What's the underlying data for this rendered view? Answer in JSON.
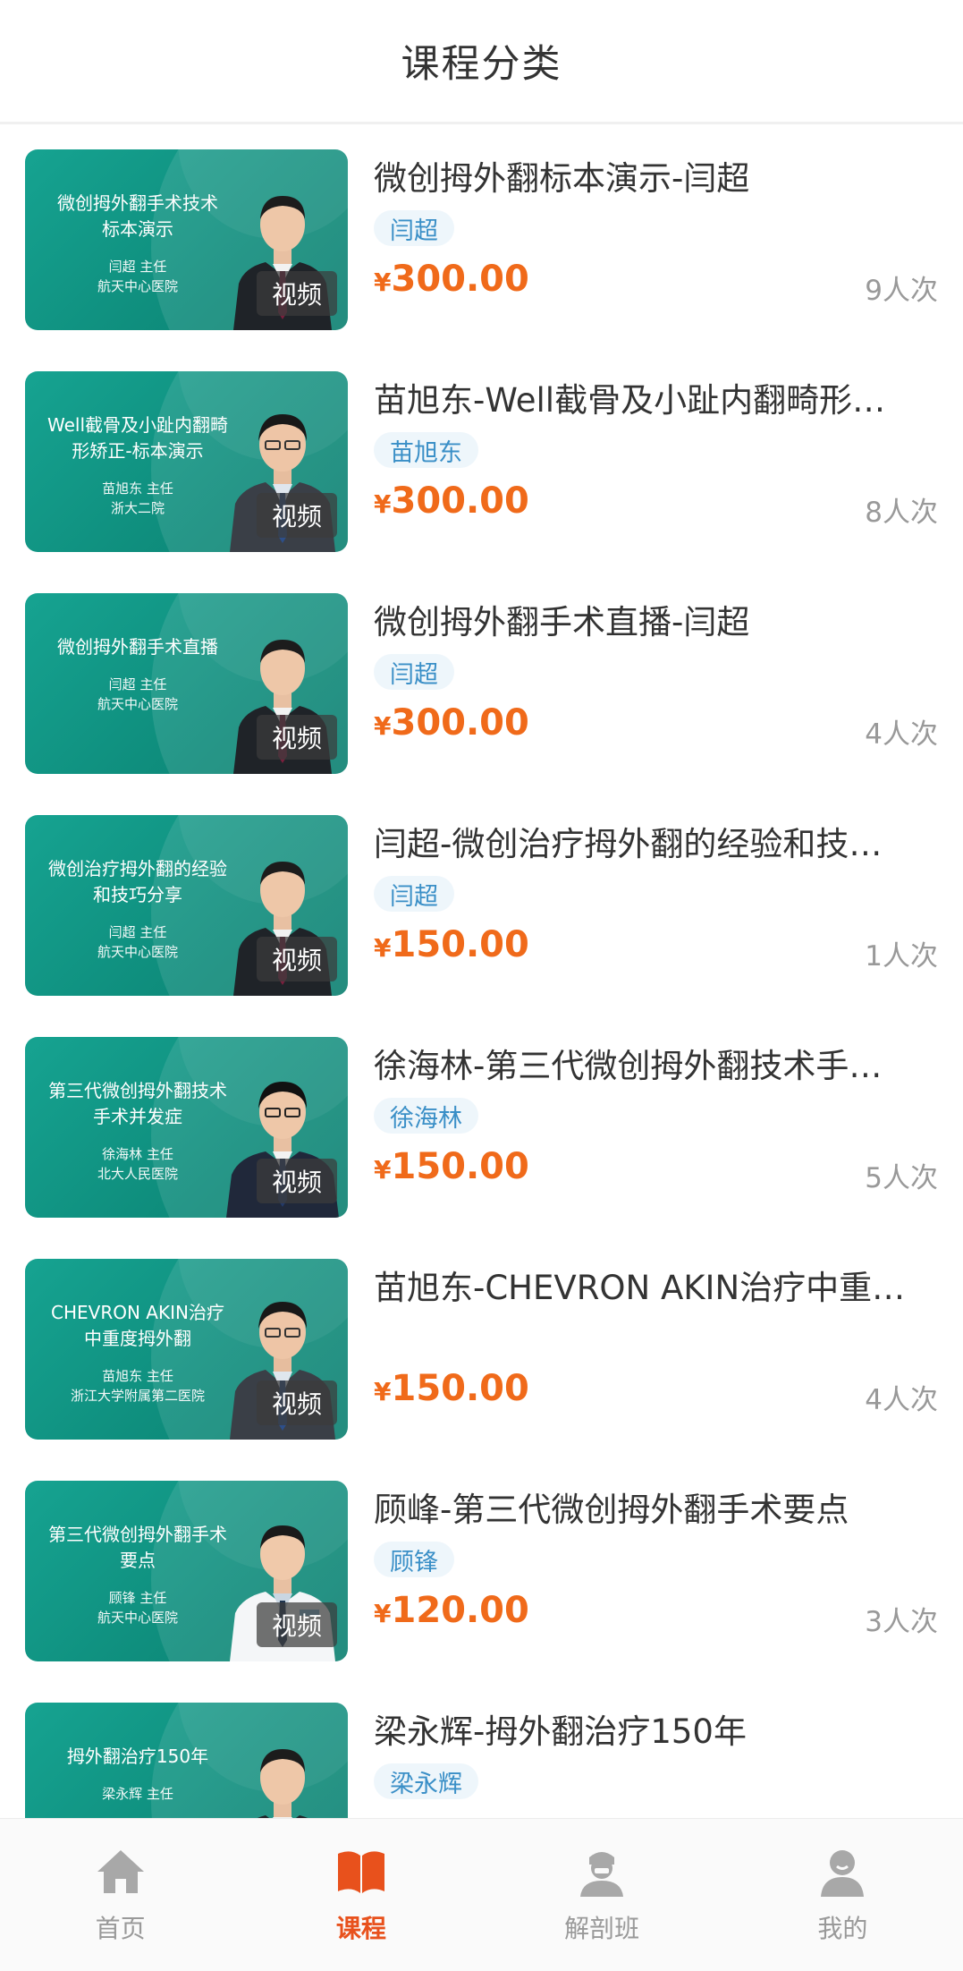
{
  "header": {
    "title": "课程分类"
  },
  "common": {
    "video_label": "视频",
    "currency": "¥"
  },
  "courses": [
    {
      "thumb_title": "微创拇外翻手术技术\n标本演示",
      "thumb_info": "闫超  主任\n航天中心医院",
      "title": "微创拇外翻标本演示-闫超",
      "teacher": "闫超",
      "price": "300.00",
      "count": "9人次"
    },
    {
      "thumb_title": "Well截骨及小趾内翻畸\n形矫正-标本演示",
      "thumb_info": "苗旭东  主任\n浙大二院",
      "title": "苗旭东-Well截骨及小趾内翻畸形…",
      "teacher": "苗旭东",
      "price": "300.00",
      "count": "8人次"
    },
    {
      "thumb_title": "微创拇外翻手术直播",
      "thumb_info": "闫超  主任\n航天中心医院",
      "title": "微创拇外翻手术直播-闫超",
      "teacher": "闫超",
      "price": "300.00",
      "count": "4人次"
    },
    {
      "thumb_title": "微创治疗拇外翻的经验\n和技巧分享",
      "thumb_info": "闫超  主任\n航天中心医院",
      "title": "闫超-微创治疗拇外翻的经验和技…",
      "teacher": "闫超",
      "price": "150.00",
      "count": "1人次"
    },
    {
      "thumb_title": "第三代微创拇外翻技术\n手术并发症",
      "thumb_info": "徐海林  主任\n北大人民医院",
      "title": "徐海林-第三代微创拇外翻技术手…",
      "teacher": "徐海林",
      "price": "150.00",
      "count": "5人次"
    },
    {
      "thumb_title": "CHEVRON AKIN治疗\n中重度拇外翻",
      "thumb_info": "苗旭东  主任\n浙江大学附属第二医院",
      "title": "苗旭东-CHEVRON AKIN治疗中重…",
      "teacher": "",
      "price": "150.00",
      "count": "4人次"
    },
    {
      "thumb_title": "第三代微创拇外翻手术\n要点",
      "thumb_info": "顾锋  主任\n航天中心医院",
      "title": "顾峰-第三代微创拇外翻手术要点",
      "teacher": "顾锋",
      "price": "120.00",
      "count": "3人次"
    },
    {
      "thumb_title": "拇外翻治疗150年",
      "thumb_info": "梁永辉  主任",
      "title": "梁永辉-拇外翻治疗150年",
      "teacher": "梁永辉",
      "price": "",
      "count": ""
    }
  ],
  "tabs": [
    {
      "label": "首页",
      "icon": "home-icon",
      "active": false
    },
    {
      "label": "课程",
      "icon": "book-icon",
      "active": true
    },
    {
      "label": "解剖班",
      "icon": "doctor-icon",
      "active": false
    },
    {
      "label": "我的",
      "icon": "user-icon",
      "active": false
    }
  ],
  "colors": {
    "accent": "#e8511c",
    "price": "#f06a1a",
    "thumb_bg": "#13998a",
    "tag_text": "#3a8fc7"
  }
}
